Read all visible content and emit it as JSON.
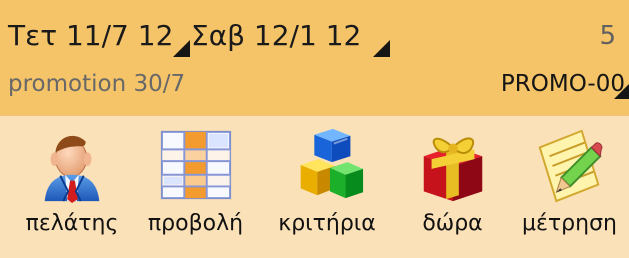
{
  "header": {
    "start_date": "Τετ 11/7 12",
    "end_date": "Σαβ 12/1 12",
    "count": "5"
  },
  "promotion": {
    "name": "promotion 30/7",
    "code": "PROMO-00"
  },
  "toolbar": {
    "items": [
      {
        "label": "πελάτης",
        "icon": "customer-icon"
      },
      {
        "label": "προβολή",
        "icon": "table-view-icon"
      },
      {
        "label": "κριτήρια",
        "icon": "criteria-blocks-icon"
      },
      {
        "label": "δώρα",
        "icon": "gift-icon"
      },
      {
        "label": "μέτρηση",
        "icon": "measurement-notepad-icon"
      }
    ]
  },
  "colors": {
    "header_background": "#f5c468",
    "toolbar_background": "#fbe1b7",
    "dropdown_marker": "#151515"
  }
}
